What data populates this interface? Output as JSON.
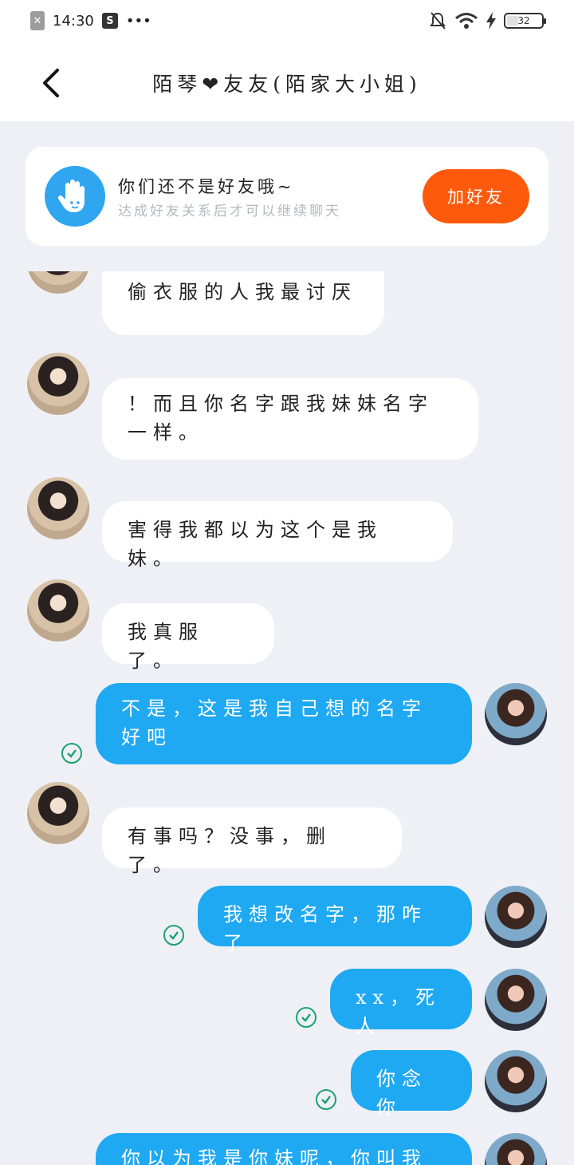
{
  "status_bar": {
    "time": "14:30",
    "sim_label": "✕",
    "s_label": "S",
    "more": "•••",
    "battery_level": "32"
  },
  "header": {
    "title": "陌琴❤友友(陌家大小姐)"
  },
  "banner": {
    "main_text": "你们还不是好友哦~",
    "sub_text": "达成好友关系后才可以继续聊天",
    "add_button": "加好友"
  },
  "messages": [
    {
      "side": "left",
      "text": "偷衣服的人我最讨厌"
    },
    {
      "side": "left",
      "text": "！而且你名字跟我妹妹名字一样。"
    },
    {
      "side": "left",
      "text": "害得我都以为这个是我妹。"
    },
    {
      "side": "left",
      "text": "我真服了。"
    },
    {
      "side": "right",
      "text": "不是，这是我自己想的名字好吧",
      "read": true
    },
    {
      "side": "left",
      "text": "有事吗？没事，删了。"
    },
    {
      "side": "right",
      "text": "我想改名字，那咋了",
      "read": true
    },
    {
      "side": "right",
      "text": "xx，死人",
      "read": true
    },
    {
      "side": "right",
      "text": "你念你",
      "read": true
    },
    {
      "side": "right",
      "text": "你以为我是你妹呢，你叫我妹"
    }
  ],
  "colors": {
    "accent_blue": "#1fa9f3",
    "add_orange": "#ff5a0c",
    "check_green": "#1aa36f",
    "background": "#eef0f5"
  }
}
